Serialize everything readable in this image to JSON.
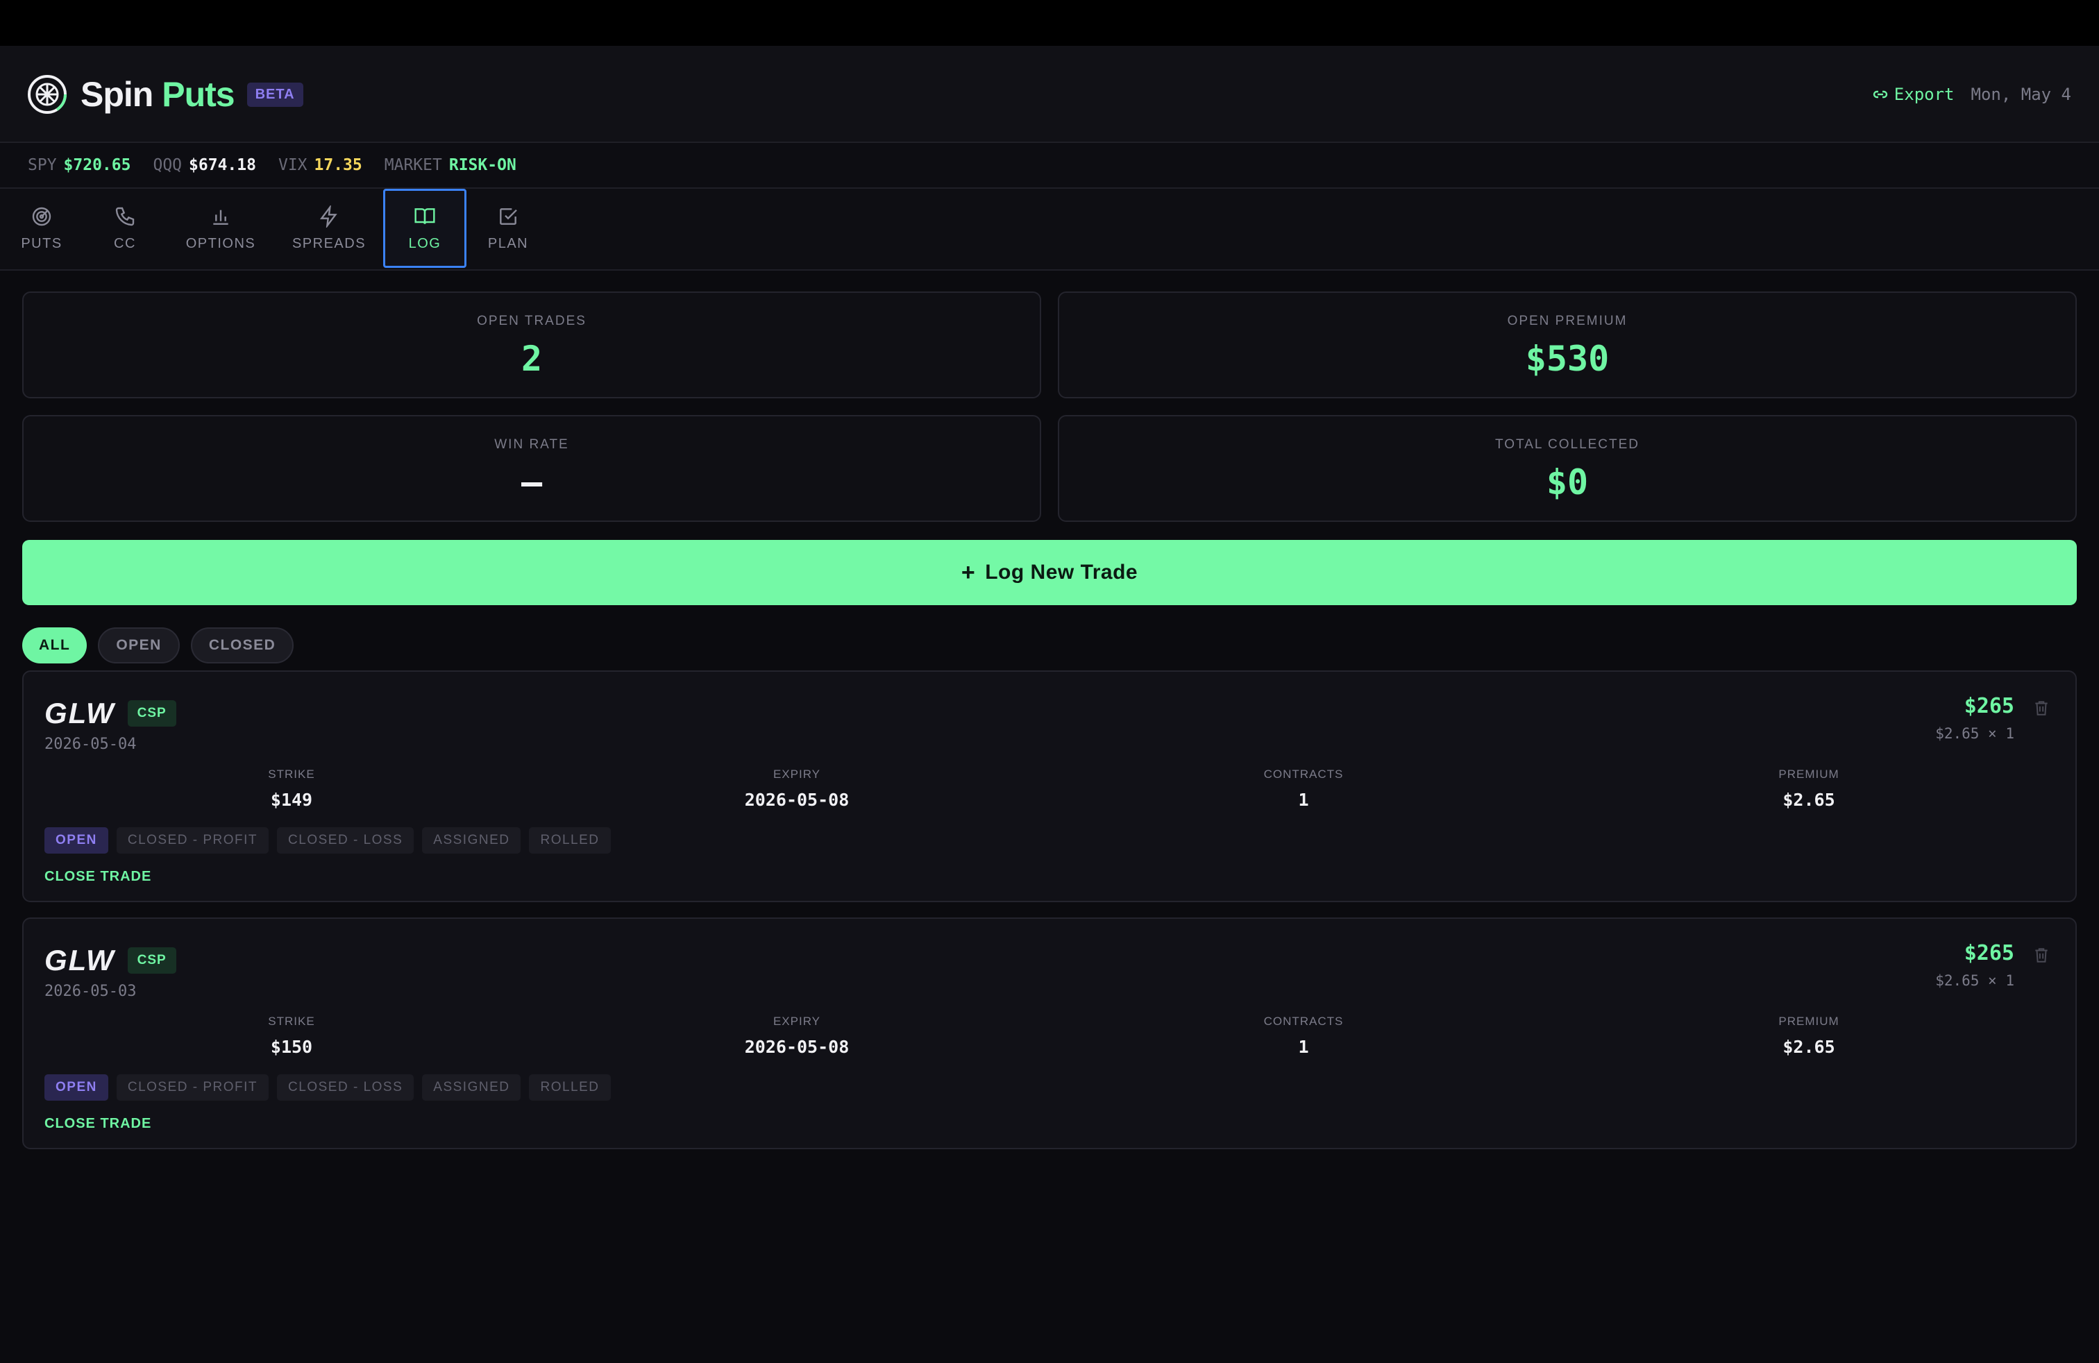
{
  "app": {
    "brand_first": "Spin",
    "brand_second": "Puts",
    "beta_label": "BETA",
    "export_label": "Export",
    "date": "Mon, May 4"
  },
  "ticker": [
    {
      "label": "SPY",
      "value": "$720.65"
    },
    {
      "label": "QQQ",
      "value": "$674.18"
    },
    {
      "label": "VIX",
      "value": "17.35"
    },
    {
      "label": "MARKET",
      "value": "RISK-ON"
    }
  ],
  "tabs": [
    {
      "label": "PUTS",
      "icon": "radar-icon"
    },
    {
      "label": "CC",
      "icon": "phone-icon"
    },
    {
      "label": "OPTIONS",
      "icon": "bar-chart-icon"
    },
    {
      "label": "SPREADS",
      "icon": "lightning-icon"
    },
    {
      "label": "LOG",
      "icon": "book-icon",
      "active": true
    },
    {
      "label": "PLAN",
      "icon": "checkbox-icon"
    }
  ],
  "stats": {
    "open_trades": {
      "label": "OPEN TRADES",
      "value": "2"
    },
    "open_premium": {
      "label": "OPEN PREMIUM",
      "value": "$530"
    },
    "win_rate": {
      "label": "WIN RATE",
      "value": "—"
    },
    "total_collected": {
      "label": "TOTAL COLLECTED",
      "value": "$0"
    }
  },
  "log_button": {
    "plus": "+",
    "label": "Log New Trade"
  },
  "filters": [
    "ALL",
    "OPEN",
    "CLOSED"
  ],
  "field_labels": {
    "strike": "STRIKE",
    "expiry": "EXPIRY",
    "contracts": "CONTRACTS",
    "premium": "PREMIUM"
  },
  "status_options": [
    "OPEN",
    "CLOSED - PROFIT",
    "CLOSED - LOSS",
    "ASSIGNED",
    "ROLLED"
  ],
  "close_label": "CLOSE TRADE",
  "trades": [
    {
      "symbol": "GLW",
      "type": "CSP",
      "date": "2026-05-04",
      "total": "$265",
      "calc": "$2.65 × 1",
      "strike": "$149",
      "expiry": "2026-05-08",
      "contracts": "1",
      "premium": "$2.65"
    },
    {
      "symbol": "GLW",
      "type": "CSP",
      "date": "2026-05-03",
      "total": "$265",
      "calc": "$2.65 × 1",
      "strike": "$150",
      "expiry": "2026-05-08",
      "contracts": "1",
      "premium": "$2.65"
    }
  ],
  "colors": {
    "accent": "#6ff5a3",
    "purple": "#8f7ff2",
    "yellow": "#f5d65c",
    "bg": "#0b0b0f"
  }
}
